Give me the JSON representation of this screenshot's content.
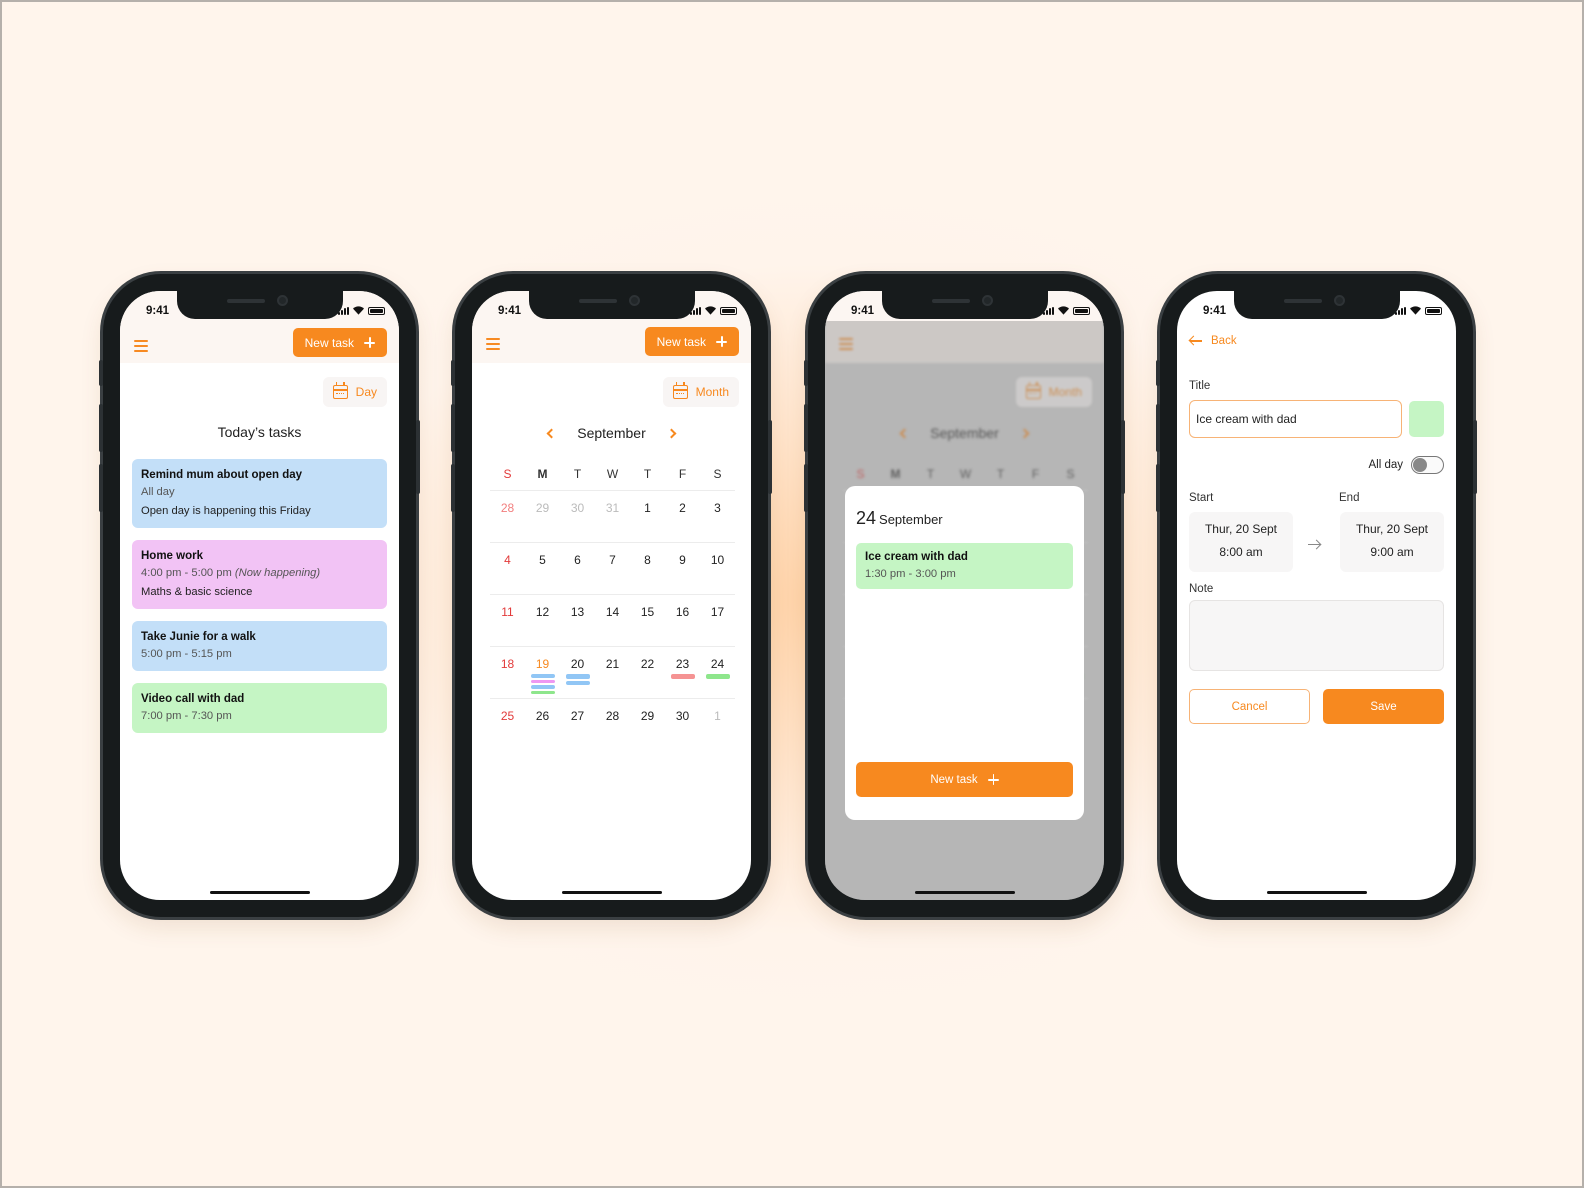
{
  "accent_color": "#f7891f",
  "status_bar": {
    "time": "9:41"
  },
  "phone1": {
    "new_task_label": "New task",
    "view_label": "Day",
    "title": "Today’s tasks",
    "tasks": [
      {
        "title": "Remind mum about open day",
        "time": "All day",
        "note": "Open day is happening this Friday",
        "color": "#c3dff8"
      },
      {
        "title": "Home work",
        "time": "4:00 pm - 5:00 pm",
        "status": "(Now happening)",
        "note": "Maths & basic science",
        "color": "#f2c3f5"
      },
      {
        "title": "Take Junie for a walk",
        "time": "5:00 pm - 5:15 pm",
        "color": "#c3dff8"
      },
      {
        "title": "Video call with dad",
        "time": "7:00 pm - 7:30 pm",
        "color": "#c5f5c4"
      }
    ]
  },
  "phone2": {
    "new_task_label": "New task",
    "view_label": "Month",
    "month": "September",
    "weekdays": [
      "S",
      "M",
      "T",
      "W",
      "T",
      "F",
      "S"
    ],
    "weeks": [
      [
        {
          "d": "28",
          "out": true
        },
        {
          "d": "29",
          "out": true
        },
        {
          "d": "30",
          "out": true
        },
        {
          "d": "31",
          "out": true
        },
        {
          "d": "1"
        },
        {
          "d": "2"
        },
        {
          "d": "3"
        }
      ],
      [
        {
          "d": "4"
        },
        {
          "d": "5"
        },
        {
          "d": "6"
        },
        {
          "d": "7"
        },
        {
          "d": "8"
        },
        {
          "d": "9"
        },
        {
          "d": "10"
        }
      ],
      [
        {
          "d": "11"
        },
        {
          "d": "12"
        },
        {
          "d": "13"
        },
        {
          "d": "14"
        },
        {
          "d": "15"
        },
        {
          "d": "16"
        },
        {
          "d": "17"
        }
      ],
      [
        {
          "d": "18"
        },
        {
          "d": "19",
          "today": true,
          "events": [
            "#91c6f5",
            "#ee98f2",
            "#91c6f5",
            "#8ee68c"
          ]
        },
        {
          "d": "20",
          "events": [
            "#91c6f5",
            "#91c6f5"
          ]
        },
        {
          "d": "21"
        },
        {
          "d": "22"
        },
        {
          "d": "23",
          "events": [
            "#f59393"
          ]
        },
        {
          "d": "24",
          "events": [
            "#8ee68c"
          ]
        }
      ],
      [
        {
          "d": "25"
        },
        {
          "d": "26"
        },
        {
          "d": "27"
        },
        {
          "d": "28"
        },
        {
          "d": "29"
        },
        {
          "d": "30"
        },
        {
          "d": "1",
          "out": true
        }
      ]
    ]
  },
  "phone3": {
    "view_label": "Month",
    "month": "September",
    "weekdays": [
      "S",
      "M",
      "T",
      "W",
      "T",
      "F",
      "S"
    ],
    "modal": {
      "day": "24",
      "month": "September",
      "event": {
        "title": "Ice cream with dad",
        "time": "1:30 pm - 3:00 pm",
        "color": "#c5f5c4"
      },
      "new_task_label": "New task"
    }
  },
  "phone4": {
    "back_label": "Back",
    "title_label": "Title",
    "title_value": "Ice cream with dad",
    "color_swatch": "#c5f5c4",
    "all_day_label": "All day",
    "all_day_on": false,
    "start_label": "Start",
    "start_date": "Thur, 20 Sept",
    "start_time": "8:00 am",
    "end_label": "End",
    "end_date": "Thur, 20 Sept",
    "end_time": "9:00 am",
    "note_label": "Note",
    "note_value": "",
    "cancel_label": "Cancel",
    "save_label": "Save"
  }
}
